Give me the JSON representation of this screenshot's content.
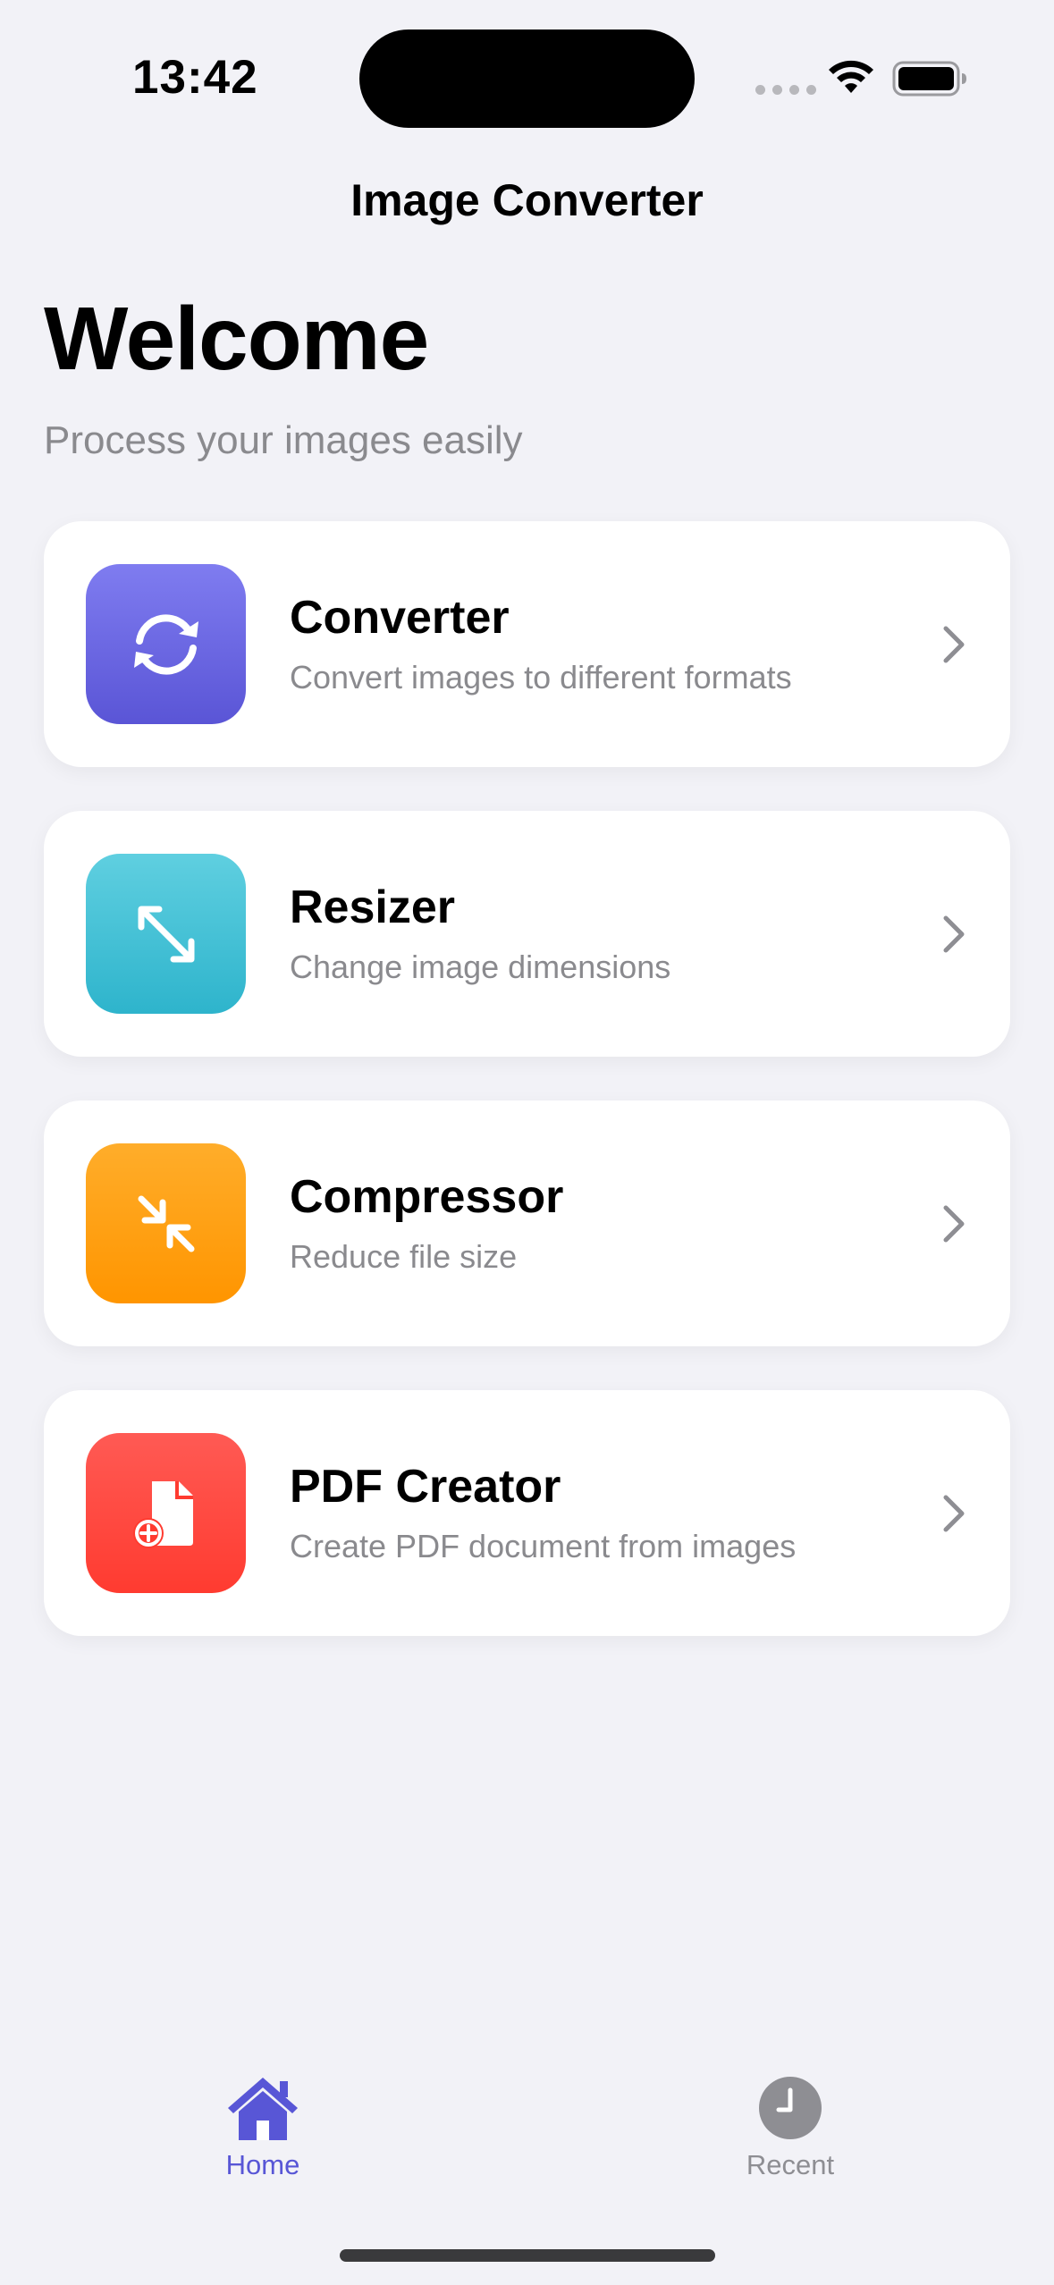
{
  "status_bar": {
    "time": "13:42"
  },
  "nav": {
    "title": "Image Converter"
  },
  "welcome": {
    "title": "Welcome",
    "subtitle": "Process your images easily"
  },
  "cards": [
    {
      "title": "Converter",
      "description": "Convert images to different formats",
      "icon": "arrows-rotate-icon",
      "color": "#5e5ce6"
    },
    {
      "title": "Resizer",
      "description": "Change image dimensions",
      "icon": "expand-arrows-icon",
      "color": "#30b0c7"
    },
    {
      "title": "Compressor",
      "description": "Reduce file size",
      "icon": "compress-arrows-icon",
      "color": "#ff9500"
    },
    {
      "title": "PDF Creator",
      "description": "Create PDF document from images",
      "icon": "document-plus-icon",
      "color": "#ff3b30"
    }
  ],
  "tabs": [
    {
      "label": "Home",
      "icon": "house-icon",
      "active": true
    },
    {
      "label": "Recent",
      "icon": "clock-icon",
      "active": false
    }
  ],
  "colors": {
    "accent": "#5856d6",
    "background": "#f2f2f7"
  }
}
